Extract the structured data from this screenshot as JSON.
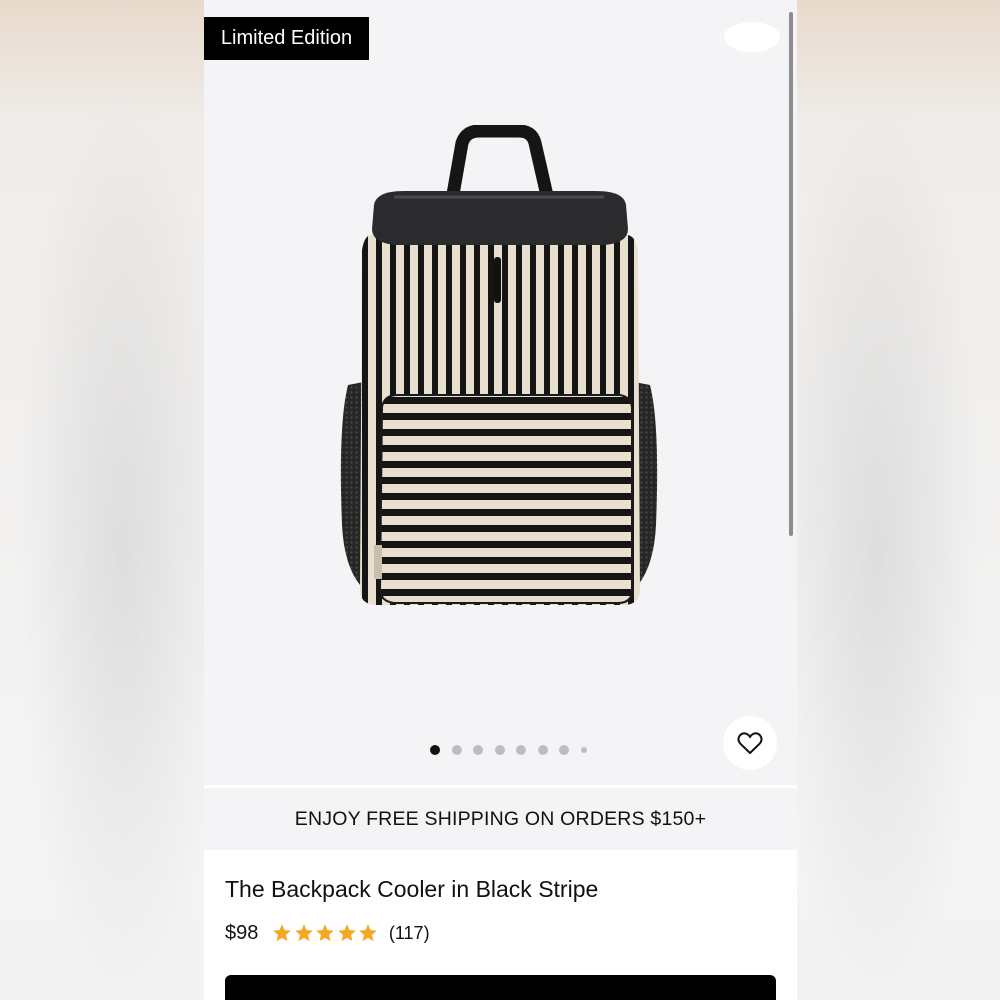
{
  "gallery": {
    "badge": "Limited Edition",
    "image_alt": "The Backpack Cooler in Black Stripe",
    "dots_total": 8,
    "active_dot": 0,
    "favorite_icon": "heart-icon"
  },
  "promo": {
    "shipping": "ENJOY FREE SHIPPING ON ORDERS $150+"
  },
  "product": {
    "title": "The Backpack Cooler in Black Stripe",
    "price": "$98",
    "rating": 5,
    "review_count": "(117)"
  },
  "colors": {
    "star": "#f5a623",
    "badge_bg": "#000000",
    "cart_bar": "#000000"
  }
}
